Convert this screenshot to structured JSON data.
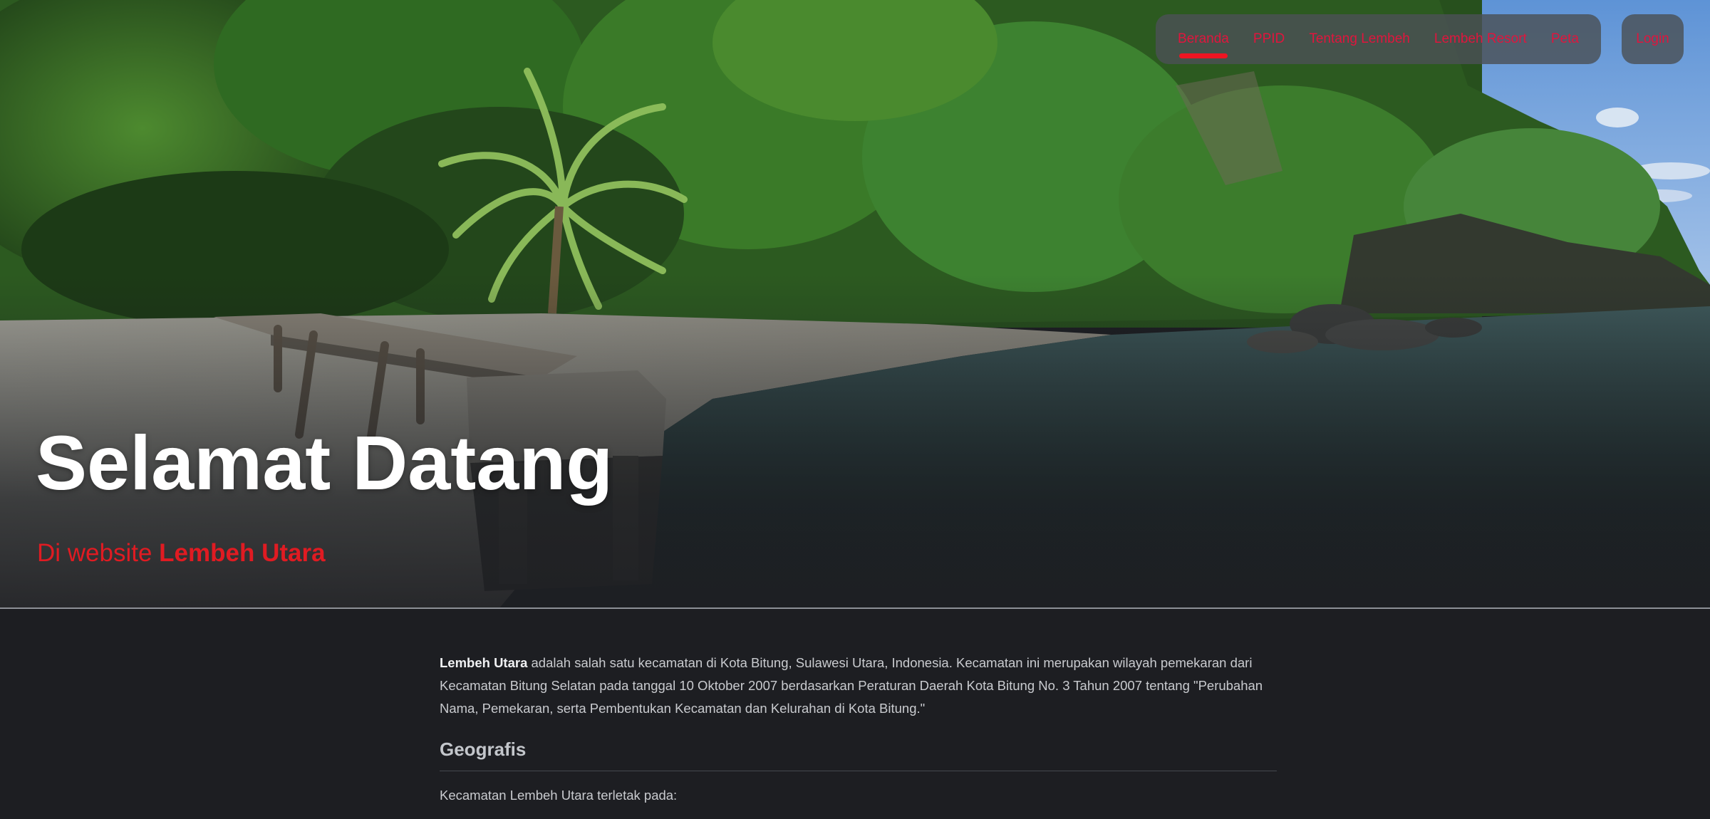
{
  "nav": {
    "items": [
      {
        "label": "Beranda",
        "active": true
      },
      {
        "label": "PPID",
        "active": false
      },
      {
        "label": "Tentang Lembeh",
        "active": false
      },
      {
        "label": "Lembeh Resort",
        "active": false
      },
      {
        "label": "Peta",
        "active": false
      }
    ],
    "login_label": "Login"
  },
  "hero": {
    "title": "Selamat Datang",
    "subtitle_prefix": "Di website ",
    "subtitle_highlight": "Lembeh Utara"
  },
  "content": {
    "intro_bold": "Lembeh Utara",
    "intro_text": " adalah salah satu kecamatan di Kota Bitung, Sulawesi Utara, Indonesia. Kecamatan ini merupakan wilayah pemekaran dari Kecamatan Bitung Selatan pada tanggal 10 Oktober 2007 berdasarkan Peraturan Daerah Kota Bitung No. 3 Tahun 2007 tentang \"Perubahan Nama, Pemekaran, serta Pembentukan Kecamatan dan Kelurahan di Kota Bitung.\"",
    "geografis_heading": "Geografis",
    "geografis_text": "Kecamatan Lembeh Utara terletak pada:"
  },
  "colors": {
    "accent": "#e0153d",
    "active_underline": "#ee1522",
    "background": "#1d1e22"
  }
}
